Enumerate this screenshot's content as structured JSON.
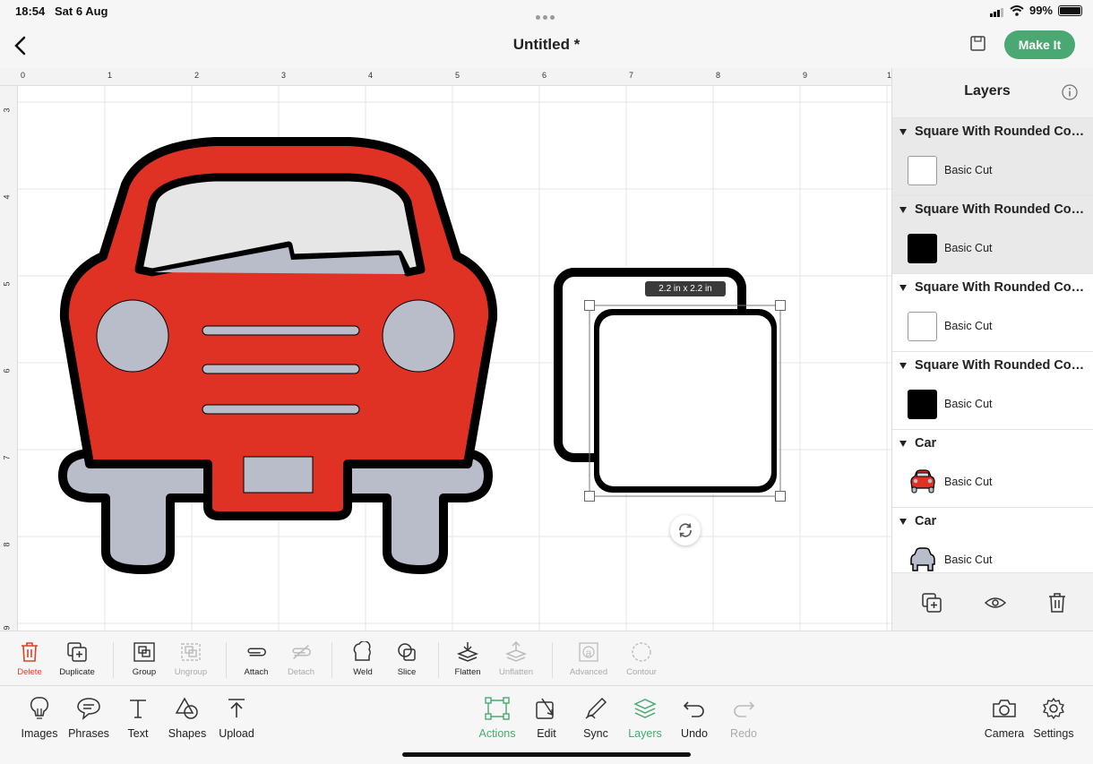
{
  "status": {
    "time": "18:54",
    "date": "Sat 6 Aug",
    "battery": "99%"
  },
  "header": {
    "title": "Untitled *",
    "make_it": "Make It"
  },
  "canvas": {
    "ruler_top": [
      "0",
      "1",
      "2",
      "3",
      "4",
      "5",
      "6",
      "7",
      "8",
      "9",
      "1"
    ],
    "ruler_left": [
      "3",
      "4",
      "5",
      "6",
      "7",
      "8",
      "9"
    ],
    "size_tooltip": "2.2 in x 2.2 in"
  },
  "layers": {
    "title": "Layers",
    "groups": [
      {
        "name": "Square With Rounded Corners",
        "item": "Basic Cut",
        "thumb": "white"
      },
      {
        "name": "Square With Rounded Corners",
        "item": "Basic Cut",
        "thumb": "black"
      },
      {
        "name": "Square With Rounded Corners",
        "item": "Basic Cut",
        "thumb": "white"
      },
      {
        "name": "Square With Rounded Corners",
        "item": "Basic Cut",
        "thumb": "black"
      },
      {
        "name": "Car",
        "item": "Basic Cut",
        "thumb": "car-red"
      },
      {
        "name": "Car",
        "item": "Basic Cut",
        "thumb": "car-grey"
      }
    ]
  },
  "actions": {
    "delete": "Delete",
    "duplicate": "Duplicate",
    "group": "Group",
    "ungroup": "Ungroup",
    "attach": "Attach",
    "detach": "Detach",
    "weld": "Weld",
    "slice": "Slice",
    "flatten": "Flatten",
    "unflatten": "Unflatten",
    "advanced": "Advanced",
    "contour": "Contour"
  },
  "nav": {
    "images": "Images",
    "phrases": "Phrases",
    "text": "Text",
    "shapes": "Shapes",
    "upload": "Upload",
    "actions": "Actions",
    "edit": "Edit",
    "sync": "Sync",
    "layers": "Layers",
    "undo": "Undo",
    "redo": "Redo",
    "camera": "Camera",
    "settings": "Settings"
  },
  "colors": {
    "accent": "#4aa872",
    "car_red": "#e03224",
    "car_grey": "#b9bcc9",
    "delete_red": "#d9432a"
  }
}
